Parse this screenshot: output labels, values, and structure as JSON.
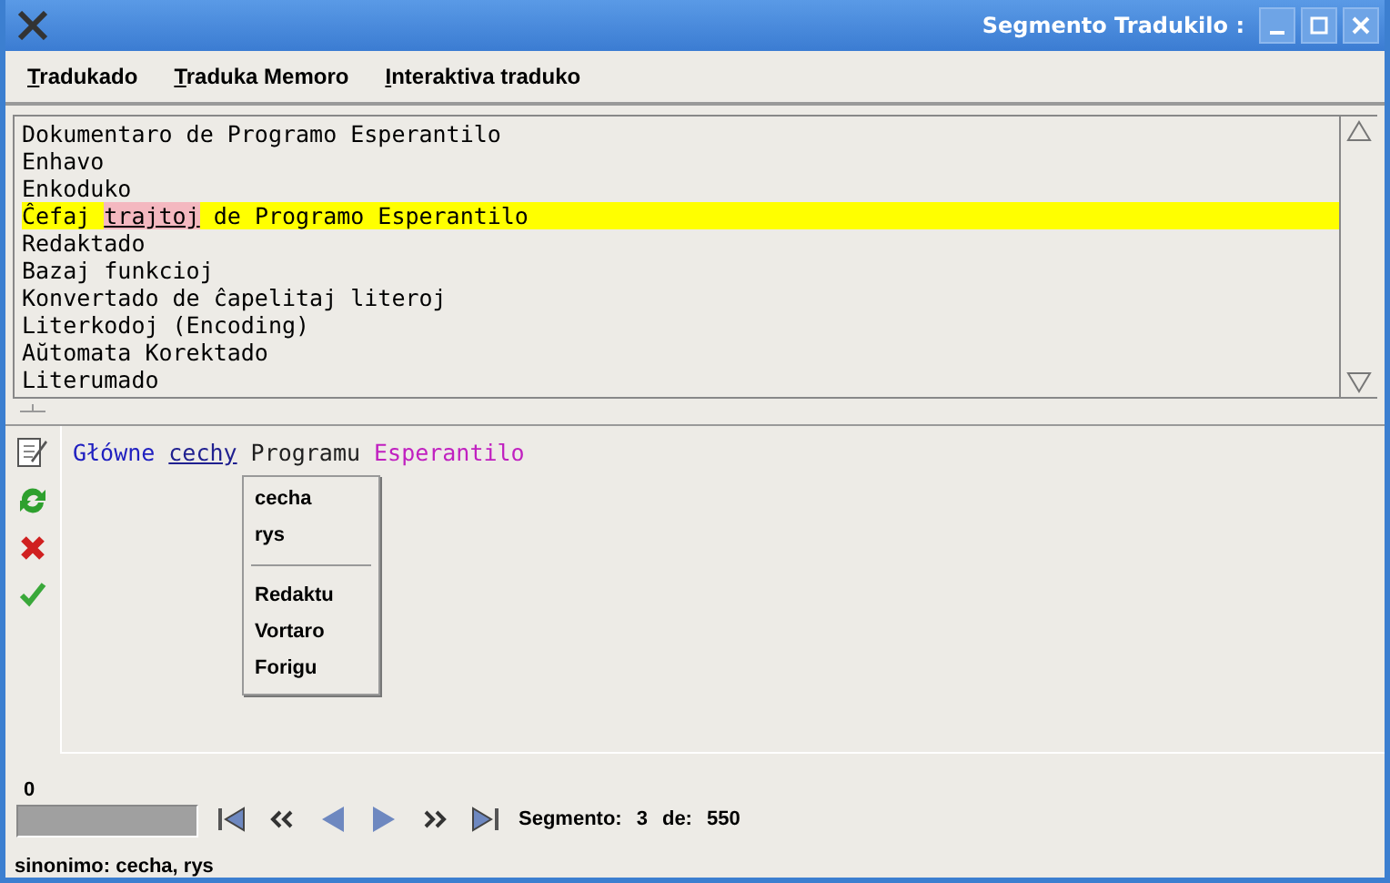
{
  "window": {
    "title": "Segmento Tradukilo :"
  },
  "menu": [
    {
      "label": "Tradukado"
    },
    {
      "label": "Traduka Memoro"
    },
    {
      "label": "Interaktiva traduko"
    }
  ],
  "segments": [
    {
      "selected": false,
      "parts": [
        {
          "text": "Dokumentaro de Programo Esperantilo",
          "marked": false
        }
      ]
    },
    {
      "selected": false,
      "parts": [
        {
          "text": "Enhavo",
          "marked": false
        }
      ]
    },
    {
      "selected": false,
      "parts": [
        {
          "text": "Enkoduko",
          "marked": false
        }
      ]
    },
    {
      "selected": true,
      "parts": [
        {
          "text": "Ĉefaj ",
          "marked": false
        },
        {
          "text": "trajtoj",
          "marked": true
        },
        {
          "text": " de Programo Esperantilo",
          "marked": false
        }
      ]
    },
    {
      "selected": false,
      "parts": [
        {
          "text": "Redaktado",
          "marked": false
        }
      ]
    },
    {
      "selected": false,
      "parts": [
        {
          "text": "Bazaj funkcioj",
          "marked": false
        }
      ]
    },
    {
      "selected": false,
      "parts": [
        {
          "text": "Konvertado de ĉapelitaj literoj",
          "marked": false
        }
      ]
    },
    {
      "selected": false,
      "parts": [
        {
          "text": "Literkodoj (Encoding)",
          "marked": false
        }
      ]
    },
    {
      "selected": false,
      "parts": [
        {
          "text": "Aŭtomata Korektado",
          "marked": false
        }
      ]
    },
    {
      "selected": false,
      "parts": [
        {
          "text": "Literumado",
          "marked": false
        }
      ]
    }
  ],
  "translation": [
    {
      "text": "Główne",
      "color": "#2020c0",
      "underlined": false
    },
    {
      "text": "cechy",
      "color": "#202090",
      "underlined": true
    },
    {
      "text": "Programu",
      "color": "#202020",
      "underlined": false
    },
    {
      "text": "Esperantilo",
      "color": "#c020c0",
      "underlined": false
    }
  ],
  "context_menu": [
    {
      "kind": "item",
      "label": "cecha"
    },
    {
      "kind": "item",
      "label": "rys"
    },
    {
      "kind": "separator"
    },
    {
      "kind": "item",
      "label": "Redaktu"
    },
    {
      "kind": "item",
      "label": "Vortaro"
    },
    {
      "kind": "item",
      "label": "Forigu"
    }
  ],
  "progress": {
    "label": "0",
    "level": 0
  },
  "navigation": {
    "segment_label": "Segmento:",
    "segment": "3",
    "total_label": "de:",
    "total": "550"
  },
  "status_bar": "sinonimo: cecha, rys"
}
